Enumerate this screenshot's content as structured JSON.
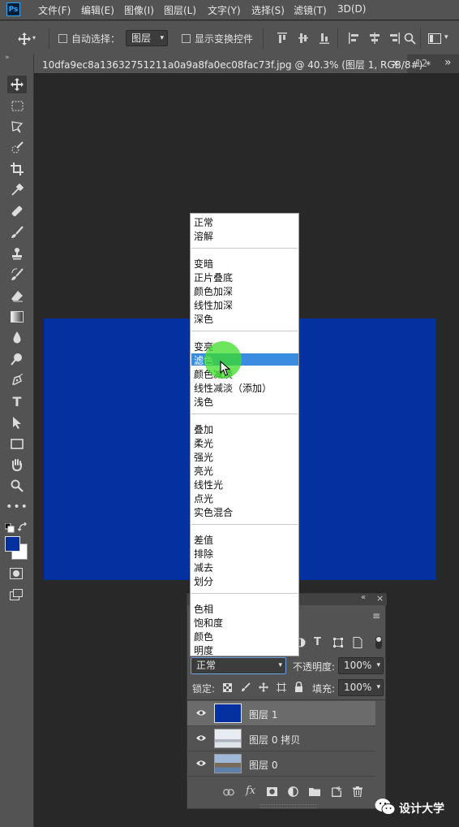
{
  "app": {
    "logo": "Ps"
  },
  "menubar": {
    "items": [
      "文件(F)",
      "编辑(E)",
      "图像(I)",
      "图层(L)",
      "文字(Y)",
      "选择(S)",
      "滤镜(T)",
      "3D(D)"
    ]
  },
  "options_bar": {
    "auto_select_label": "自动选择：",
    "auto_select_value": "图层",
    "show_transform_label": "显示变换控件"
  },
  "tabs": {
    "active_title": "10dfa9ec8a13632751211a0a9a8fa0ec08fac73f.jpg @ 40.3% (图层 1, RGB/8#) *",
    "close_glyph": "×",
    "next_tab_partial": "12",
    "overflow_glyph": "»"
  },
  "canvas": {
    "document_color": "#0331a0"
  },
  "blend_menu": {
    "groups": [
      [
        "正常",
        "溶解"
      ],
      [
        "变暗",
        "正片叠底",
        "颜色加深",
        "线性加深",
        "深色"
      ],
      [
        "变亮",
        "滤色",
        "颜色减淡",
        "线性减淡（添加）",
        "浅色"
      ],
      [
        "叠加",
        "柔光",
        "强光",
        "亮光",
        "线性光",
        "点光",
        "实色混合"
      ],
      [
        "差值",
        "排除",
        "减去",
        "划分"
      ],
      [
        "色相",
        "饱和度",
        "颜色",
        "明度"
      ]
    ],
    "highlighted": "滤色",
    "highlight_color": "#3b8ce0"
  },
  "layers_panel": {
    "blend_mode_value": "正常",
    "opacity_label": "不透明度:",
    "opacity_value": "100%",
    "lock_label": "锁定:",
    "fill_label": "填充:",
    "fill_value": "100%",
    "layers": [
      {
        "name": "图层 1",
        "selected": true
      },
      {
        "name": "图层 0 拷贝",
        "selected": false
      },
      {
        "name": "图层 0",
        "selected": false
      }
    ]
  },
  "watermark": {
    "text": "设计大学"
  }
}
